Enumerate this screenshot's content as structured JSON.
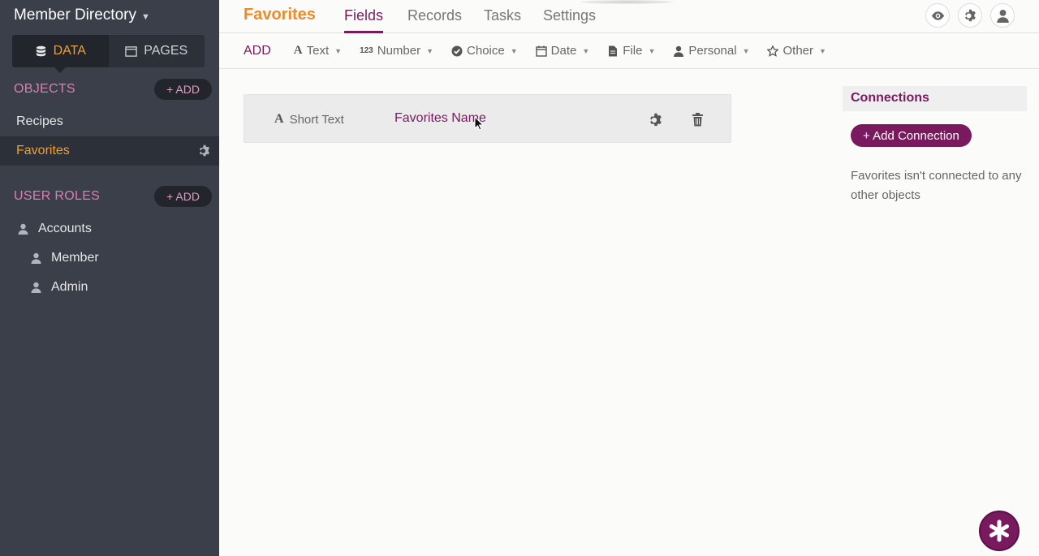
{
  "sidebar": {
    "app_title": "Member Directory",
    "modes": [
      {
        "label": "DATA",
        "icon": "database-icon",
        "active": true
      },
      {
        "label": "PAGES",
        "icon": "window-icon",
        "active": false
      }
    ],
    "objects_heading": "OBJECTS",
    "objects_add": "+ ADD",
    "objects": [
      {
        "label": "Recipes",
        "active": false
      },
      {
        "label": "Favorites",
        "active": true
      }
    ],
    "roles_heading": "USER ROLES",
    "roles_add": "+ ADD",
    "roles": [
      {
        "label": "Accounts"
      },
      {
        "label": "Member"
      },
      {
        "label": "Admin"
      }
    ]
  },
  "header": {
    "object_title": "Favorites",
    "tabs": [
      {
        "label": "Fields",
        "active": true
      },
      {
        "label": "Records",
        "active": false
      },
      {
        "label": "Tasks",
        "active": false
      },
      {
        "label": "Settings",
        "active": false
      }
    ],
    "icons": [
      "eye-icon",
      "gear-icon",
      "user-icon"
    ]
  },
  "fieldbar": {
    "add_label": "ADD",
    "types": [
      {
        "label": "Text",
        "icon": "text-icon",
        "glyph": "A"
      },
      {
        "label": "Number",
        "icon": "number-icon",
        "glyph": "123"
      },
      {
        "label": "Choice",
        "icon": "check-circle-icon"
      },
      {
        "label": "Date",
        "icon": "calendar-icon"
      },
      {
        "label": "File",
        "icon": "file-icon"
      },
      {
        "label": "Personal",
        "icon": "person-icon"
      },
      {
        "label": "Other",
        "icon": "star-icon"
      }
    ]
  },
  "field": {
    "type_label": "Short Text",
    "type_glyph": "A",
    "name": "Favorites Name"
  },
  "connections": {
    "heading": "Connections",
    "add_button": "+ Add Connection",
    "note": "Favorites isn't connected to any other objects"
  },
  "colors": {
    "accent": "#7a1a5e",
    "orange": "#f08a24",
    "sidebar": "#3a3f49",
    "pink": "#d97fb3"
  }
}
